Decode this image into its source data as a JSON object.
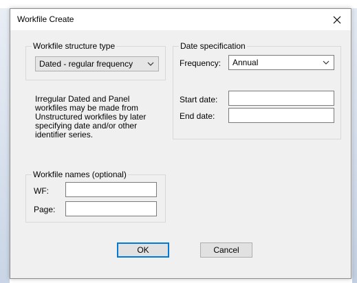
{
  "window": {
    "title": "Workfile Create",
    "close_glyph": "✕"
  },
  "structure": {
    "group_label": "Workfile structure type",
    "type_value": "Dated - regular frequency",
    "help_text": "Irregular Dated and Panel workfiles may be made from Unstructured workfiles by later specifying date and/or other identifier series."
  },
  "date_spec": {
    "group_label": "Date specification",
    "frequency_label": "Frequency:",
    "frequency_value": "Annual",
    "start_label": "Start date:",
    "start_value": "",
    "end_label": "End date:",
    "end_value": ""
  },
  "names": {
    "group_label": "Workfile names (optional)",
    "wf_label": "WF:",
    "wf_value": "",
    "page_label": "Page:",
    "page_value": ""
  },
  "buttons": {
    "ok": "OK",
    "cancel": "Cancel"
  },
  "icons": {
    "close": "close-icon",
    "dropdown": "chevron-down-icon"
  },
  "colors": {
    "default_button_border": "#0078d7",
    "dialog_bg": "#f0f0f0"
  }
}
